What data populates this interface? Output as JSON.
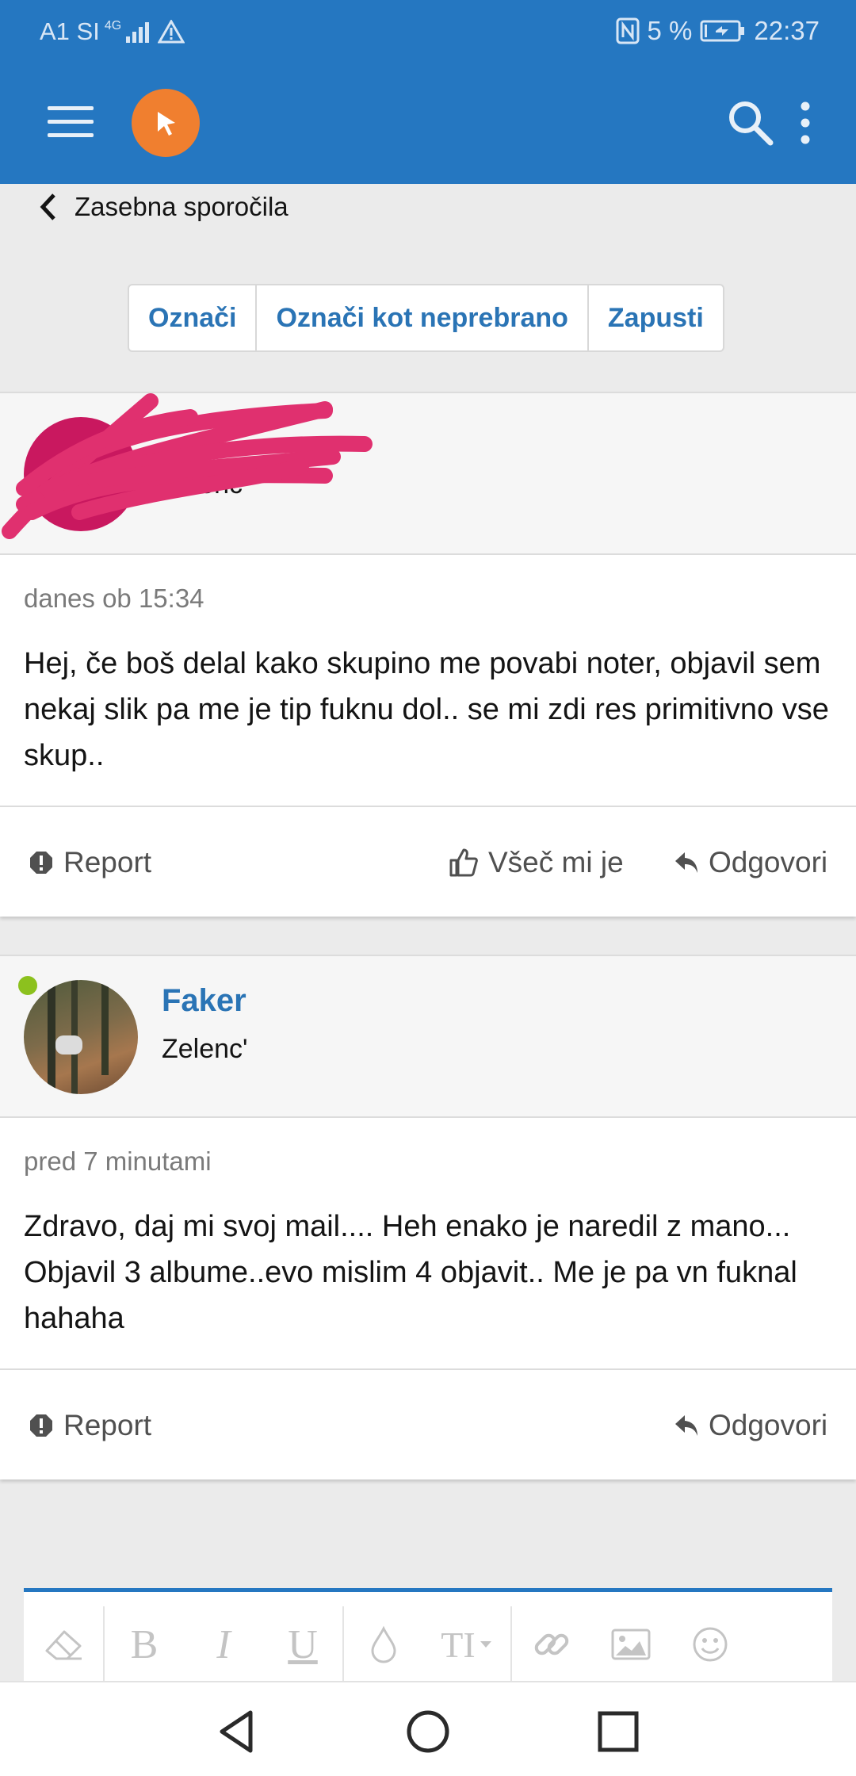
{
  "status_bar": {
    "carrier": "A1 SI",
    "network": "4G",
    "battery": "5 %",
    "time": "22:37"
  },
  "app_bar": {
    "menu_icon": "hamburger-icon",
    "logo_icon": "cursor-logo-icon",
    "search_icon": "search-icon",
    "more_icon": "more-vertical-icon"
  },
  "breadcrumb": {
    "label": "Zasebna sporočila"
  },
  "actions": {
    "mark": "Označi",
    "mark_unread": "Označi kot neprebrano",
    "leave": "Zapusti"
  },
  "messages": [
    {
      "user_name": "",
      "user_title": "Zelenc'",
      "online": false,
      "time": "danes ob 15:34",
      "text": "Hej, če boš delal kako skupino me povabi noter, objavil sem nekaj slik pa me je tip fuknu dol.. se mi zdi res primitivno vse skup..",
      "report": "Report",
      "like": "Všeč mi je",
      "reply": "Odgovori"
    },
    {
      "user_name": "Faker",
      "user_title": "Zelenc'",
      "online": true,
      "time": "pred 7 minutami",
      "text": "Zdravo, daj mi svoj mail.... Heh enako je naredil z mano... Objavil 3 albume..evo mislim 4 objavit.. Me je pa vn fuknal hahaha",
      "report": "Report",
      "reply": "Odgovori"
    }
  ],
  "editor": {
    "tools": [
      "eraser-icon",
      "bold-icon",
      "italic-icon",
      "underline-icon",
      "color-drop-icon",
      "text-size-icon",
      "link-icon",
      "image-icon",
      "emoji-icon"
    ],
    "bold": "B",
    "italic": "I",
    "underline": "U",
    "text_size": "TI"
  },
  "colors": {
    "primary": "#2577c1",
    "link": "#2a74b5",
    "logo": "#f07f2f",
    "online": "#8cc11e",
    "scribble": "#e0306f"
  }
}
